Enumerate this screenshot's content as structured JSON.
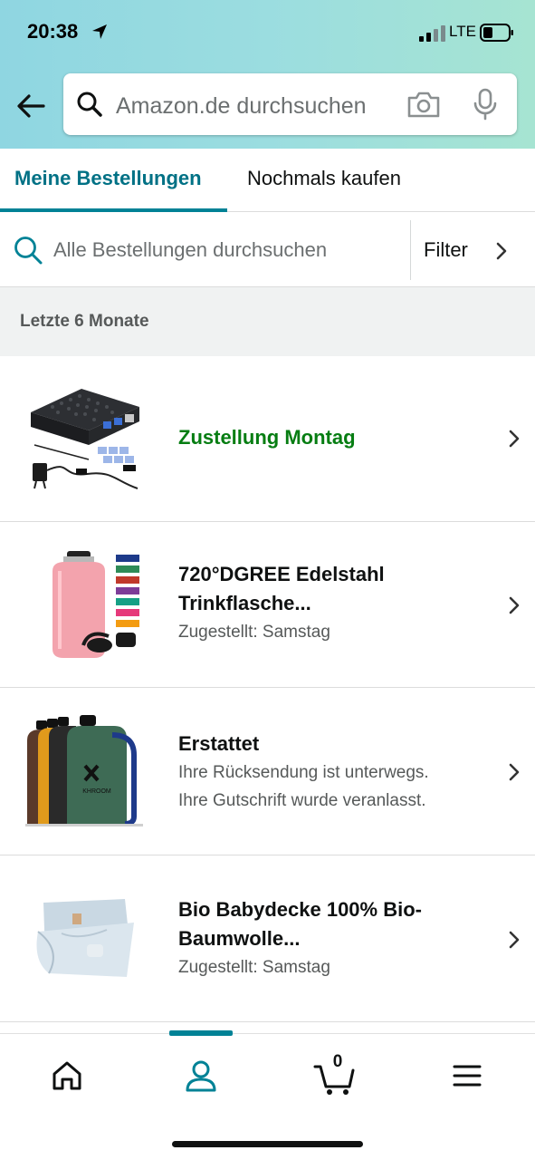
{
  "status_bar": {
    "time": "20:38",
    "network": "LTE"
  },
  "search": {
    "placeholder": "Amazon.de durchsuchen"
  },
  "tabs": [
    {
      "label": "Meine Bestellungen",
      "active": true
    },
    {
      "label": "Nochmals kaufen",
      "active": false
    }
  ],
  "order_search": {
    "placeholder": "Alle Bestellungen durchsuchen",
    "filter_label": "Filter"
  },
  "section_title": "Letzte 6 Monate",
  "orders": [
    {
      "title": "Zustellung Montag",
      "subtitle_lines": [],
      "title_color": "#067d12",
      "image": "raspberry-pi-case-kit"
    },
    {
      "title": "720°DGREE Edelstahl Trinkflasche...",
      "title_lines": [
        "720°DGREE Edelstahl",
        "Trinkflasche..."
      ],
      "subtitle_lines": [
        "Zugestellt: Samstag"
      ],
      "image": "stainless-steel-bottle"
    },
    {
      "title": "Erstattet",
      "subtitle_lines": [
        "Ihre Rücksendung ist unterwegs.",
        "Ihre Gutschrift wurde veranlasst."
      ],
      "image": "water-jugs"
    },
    {
      "title": "Bio Babydecke 100% Bio-Baumwolle...",
      "title_lines": [
        "Bio Babydecke 100% Bio-",
        "Baumwolle..."
      ],
      "subtitle_lines": [
        "Zugestellt: Samstag"
      ],
      "image": "baby-blanket"
    }
  ],
  "bottom_nav": {
    "cart_count": "0",
    "active": "account",
    "items": [
      "home-icon",
      "account-icon",
      "cart-icon",
      "menu-icon"
    ]
  },
  "colors": {
    "accent": "#008296",
    "link": "#007185",
    "delivery_green": "#067d12"
  }
}
